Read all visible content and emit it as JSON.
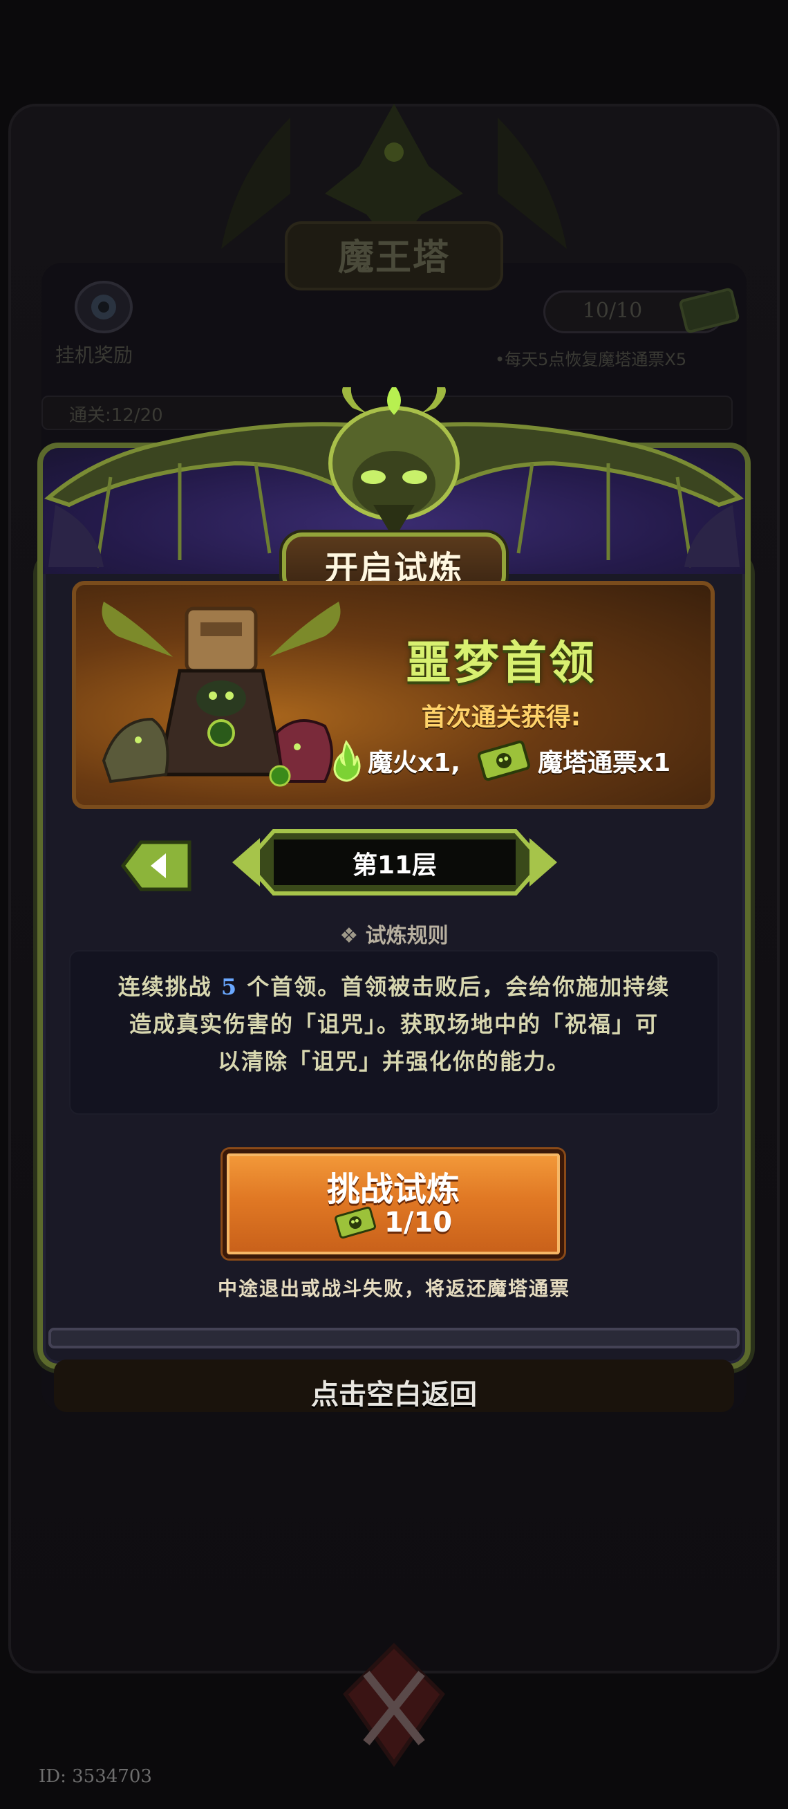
{
  "background": {
    "title": "魔王塔",
    "idle_reward_label": "挂机奖励",
    "ticket_count": "10/10",
    "ticket_recover_note": "•每天5点恢复魔塔通票X5",
    "progress_label": "通关:12/20"
  },
  "modal": {
    "title": "开启试炼",
    "boss_name": "噩梦首领",
    "first_clear_label": "首次通关获得:",
    "rewards": [
      {
        "icon": "green-flame-icon",
        "text": "魔火x1,"
      },
      {
        "icon": "ticket-icon",
        "text": "魔塔通票x1"
      }
    ],
    "floor_label": "第11层",
    "rules_title": "试炼规则",
    "rules": {
      "line1_pre": "连续挑战",
      "count": "5",
      "line1_post": "个首领。首领被击败后，会给你施加持续",
      "line2": "造成真实伤害的「诅咒」。获取场地中的「祝福」可",
      "line3": "以清除「诅咒」并强化你的能力。"
    },
    "challenge_button": "挑战试炼",
    "challenge_cost": "1/10",
    "refund_note": "中途退出或战斗失败，将返还魔塔通票"
  },
  "return_hint": "点击空白返回",
  "player_id": "ID: 3534703",
  "colors": {
    "accent_green": "#d8f070",
    "frame_green": "#5c6a2c",
    "button_orange": "#e07824",
    "rules_highlight": "#6aa8ff"
  }
}
